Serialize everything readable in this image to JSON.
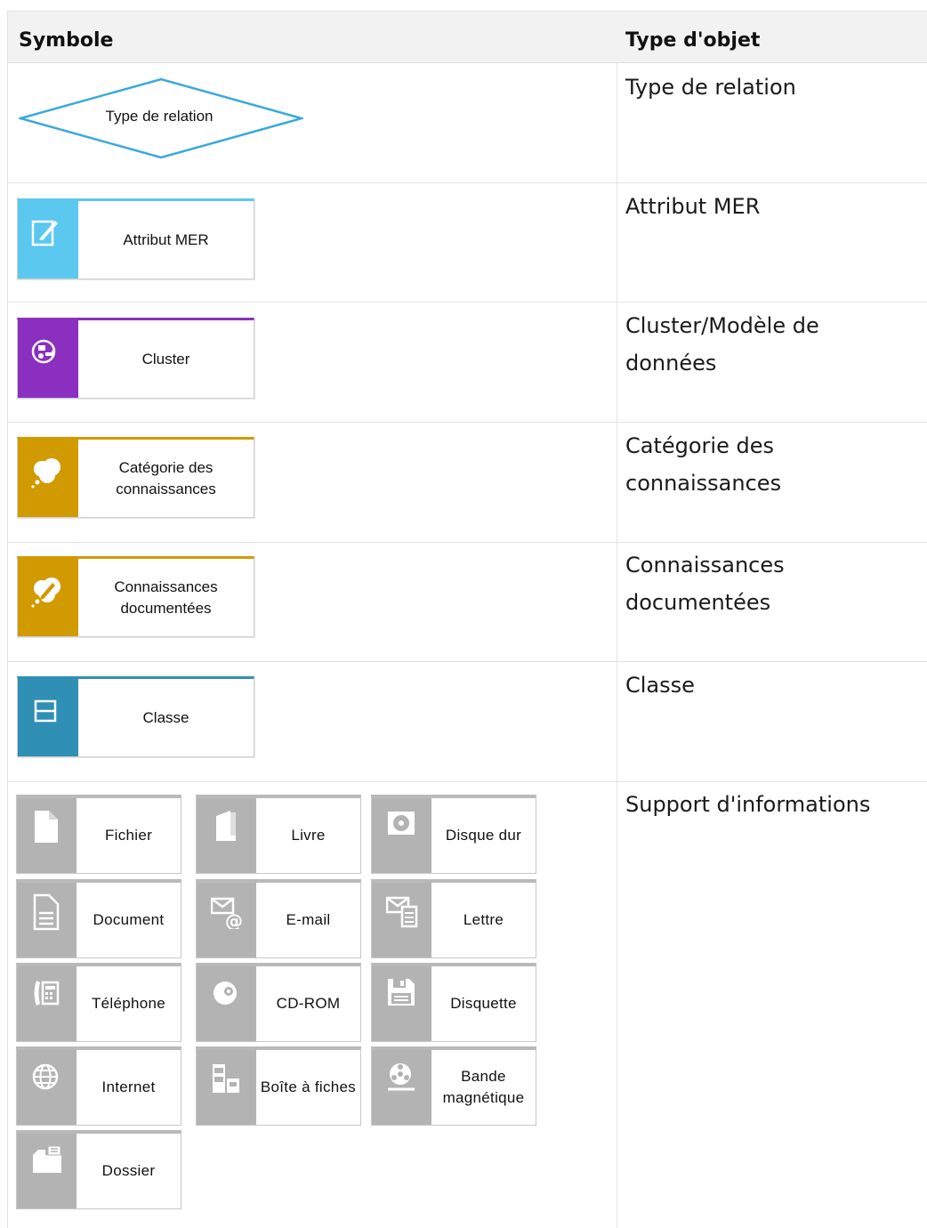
{
  "header": {
    "col_symbol": "Symbole",
    "col_type": "Type d'objet"
  },
  "rows": [
    {
      "type": "Type de relation",
      "symbol_label": "Type de relation"
    },
    {
      "type": "Attribut MER",
      "symbol_label": "Attribut MER",
      "color": "#5bc8f0"
    },
    {
      "type": "Cluster/Modèle de données",
      "symbol_label": "Cluster",
      "color": "#8a2fc0"
    },
    {
      "type": "Catégorie des connaissances",
      "symbol_label": "Catégorie des connaissances",
      "color": "#d19a00"
    },
    {
      "type": "Connaissances documentées",
      "symbol_label": "Connaissances documentées",
      "color": "#d19a00"
    },
    {
      "type": "Classe",
      "symbol_label": "Classe",
      "color": "#2f8fb5"
    },
    {
      "type": "Support d'informations"
    }
  ],
  "info_carriers": [
    {
      "label": "Fichier",
      "icon": "file-icon"
    },
    {
      "label": "Livre",
      "icon": "book-icon"
    },
    {
      "label": "Disque dur",
      "icon": "hard-disk-icon"
    },
    {
      "label": "Document",
      "icon": "document-icon"
    },
    {
      "label": "E-mail",
      "icon": "email-icon"
    },
    {
      "label": "Lettre",
      "icon": "letter-icon"
    },
    {
      "label": "Téléphone",
      "icon": "phone-icon"
    },
    {
      "label": "CD-ROM",
      "icon": "cd-icon"
    },
    {
      "label": "Disquette",
      "icon": "floppy-icon"
    },
    {
      "label": "Internet",
      "icon": "globe-icon"
    },
    {
      "label": "Boîte à fiches",
      "icon": "card-box-icon"
    },
    {
      "label": "Bande magnétique",
      "icon": "tape-icon"
    },
    {
      "label": "Dossier",
      "icon": "folder-icon"
    }
  ],
  "colors": {
    "relation_stroke": "#3aa9dc",
    "carrier_gray": "#b3b3b3"
  }
}
